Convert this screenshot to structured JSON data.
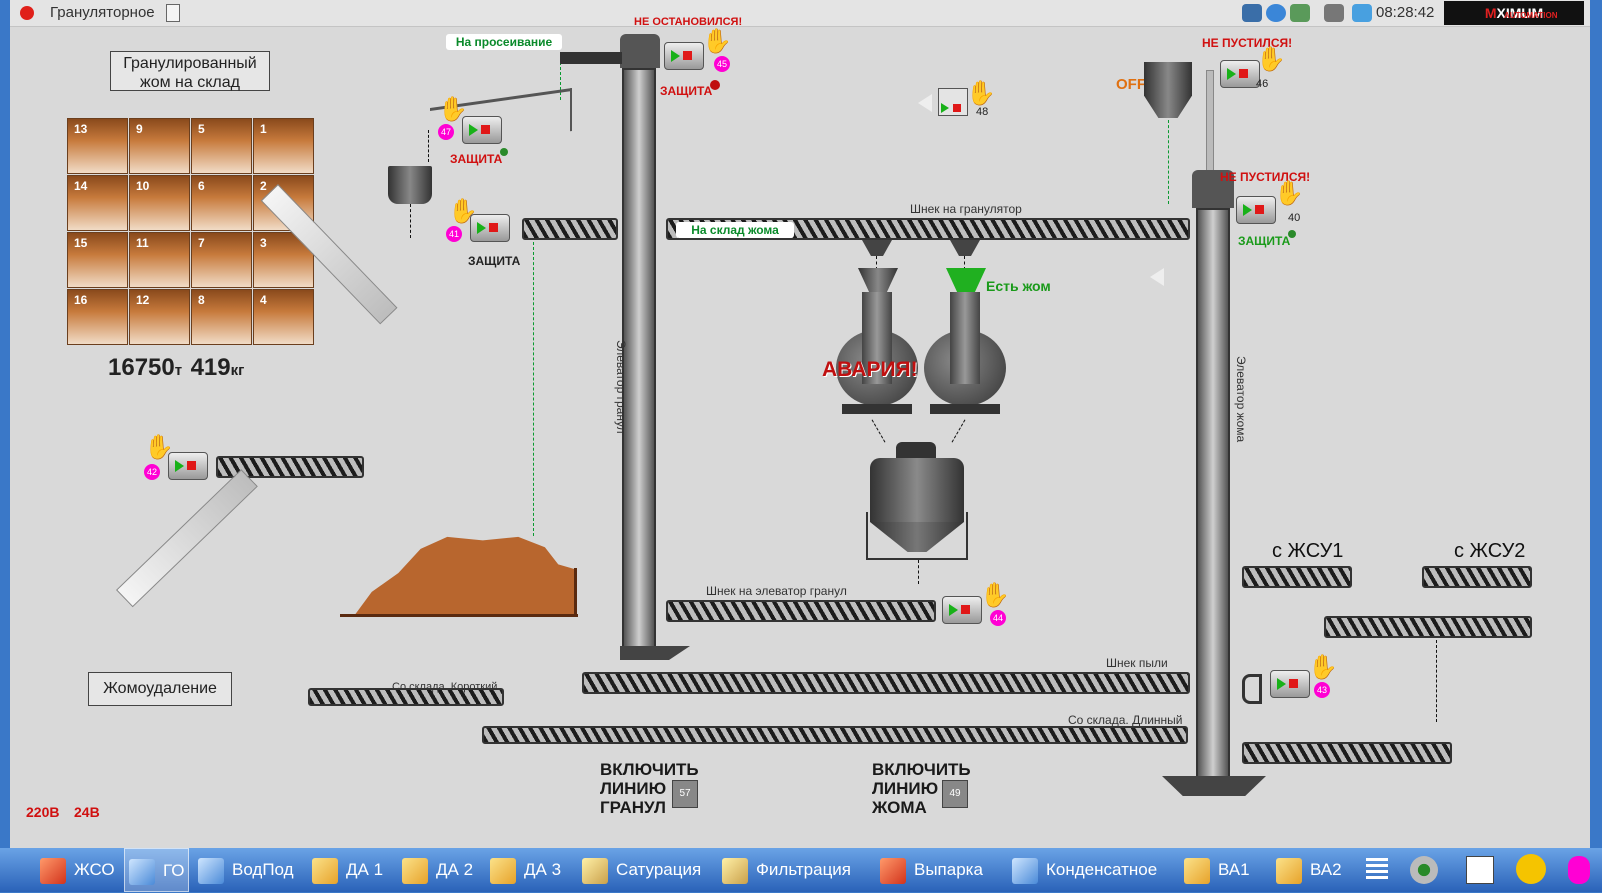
{
  "window": {
    "title": "Грануляторное",
    "clock": "08:28:42"
  },
  "logo": {
    "part1": "M",
    "part2": "XIMUM",
    "part3": "AUTOMATION"
  },
  "warehouse": {
    "title_line1": "Гранулированный",
    "title_line2": "жом на склад",
    "cells": [
      [
        "13",
        "9",
        "5",
        "1"
      ],
      [
        "14",
        "10",
        "6",
        "2"
      ],
      [
        "15",
        "11",
        "7",
        "3"
      ],
      [
        "16",
        "12",
        "8",
        "4"
      ]
    ],
    "weight_t": "16750",
    "unit_t": "т",
    "weight_kg": "419",
    "unit_kg": "кг"
  },
  "labels": {
    "to_screening": "На просеивание",
    "to_pulp_warehouse": "На склад жома",
    "not_stopped": "НЕ ОСТАНОВИЛСЯ!",
    "not_started_1": "НЕ ПУСТИЛСЯ!",
    "not_started_2": "НЕ ПУСТИЛСЯ!",
    "protection_1": "ЗАЩИТА",
    "protection_2": "ЗАЩИТА",
    "protection_3": "ЗАЩИТА",
    "protection_4": "ЗАЩИТА",
    "off": "OFF",
    "has_pulp": "Есть жом",
    "alarm": "АВАРИЯ!",
    "screw_to_granulator": "Шнек на гранулятор",
    "screw_to_granule_elevator": "Шнек на элеватор гранул",
    "dust_screw": "Шнек пыли",
    "from_warehouse_short": "Со склада. Короткий",
    "from_warehouse_long": "Со склада. Длинный",
    "granule_elevator": "Элеватор гранул",
    "pulp_elevator": "Элеватор жома",
    "from_zhsu1": "с ЖСУ1",
    "from_zhsu2": "с ЖСУ2",
    "pulp_removal": "Жомоудаление",
    "voltage_220": "220В",
    "voltage_24": "24В"
  },
  "buttons": {
    "granules_line": [
      "ВКЛЮЧИТЬ",
      "ЛИНИЮ",
      "ГРАНУЛ"
    ],
    "granules_num": "57",
    "pulp_line": [
      "ВКЛЮЧИТЬ",
      "ЛИНИЮ",
      "ЖОМА"
    ],
    "pulp_num": "49"
  },
  "motors": {
    "m45": "45",
    "m47": "47",
    "m41": "41",
    "m42": "42",
    "m46": "46",
    "m48": "48",
    "m40": "40",
    "m44": "44",
    "m43": "43"
  },
  "taskbar": [
    {
      "label": "ЖСО"
    },
    {
      "label": "ГО"
    },
    {
      "label": "ВодПод"
    },
    {
      "label": "ДА 1"
    },
    {
      "label": "ДА 2"
    },
    {
      "label": "ДА 3"
    },
    {
      "label": "Сатурация"
    },
    {
      "label": "Фильтрация"
    },
    {
      "label": "Выпарка"
    },
    {
      "label": "Конденсатное"
    },
    {
      "label": "ВА1"
    },
    {
      "label": "ВА2"
    }
  ],
  "colors": {
    "alarm": "#d01010",
    "ok": "#1a9a1a",
    "pulp": "#b8662e"
  }
}
